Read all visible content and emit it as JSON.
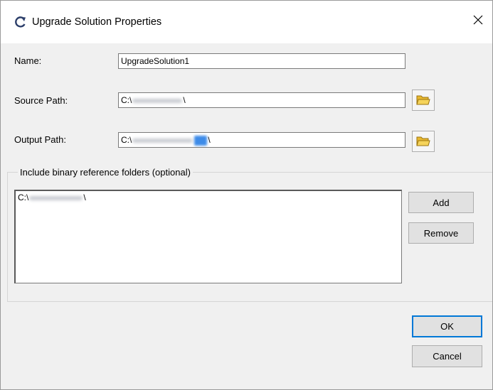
{
  "window": {
    "title": "Upgrade Solution Properties"
  },
  "title_icon": "refresh-arrow-icon",
  "close_icon": "close-icon",
  "name_field": {
    "label": "Name:",
    "value": "UpgradeSolution1"
  },
  "source_path": {
    "label": "Source Path:",
    "value_prefix": "C:\\",
    "value_suffix": "\\",
    "browse_icon": "folder-icon"
  },
  "output_path": {
    "label": "Output Path:",
    "value_prefix": "C:\\",
    "value_suffix": "\\",
    "browse_icon": "folder-icon"
  },
  "binary_refs": {
    "legend": "Include binary reference folders (optional)",
    "items": [
      {
        "prefix": "C:\\",
        "suffix": "\\"
      }
    ],
    "add_label": "Add",
    "remove_label": "Remove"
  },
  "footer": {
    "ok_label": "OK",
    "cancel_label": "Cancel"
  },
  "colors": {
    "accent": "#0078d7",
    "background": "#f0f0f0",
    "folder": "#f5d35a"
  }
}
